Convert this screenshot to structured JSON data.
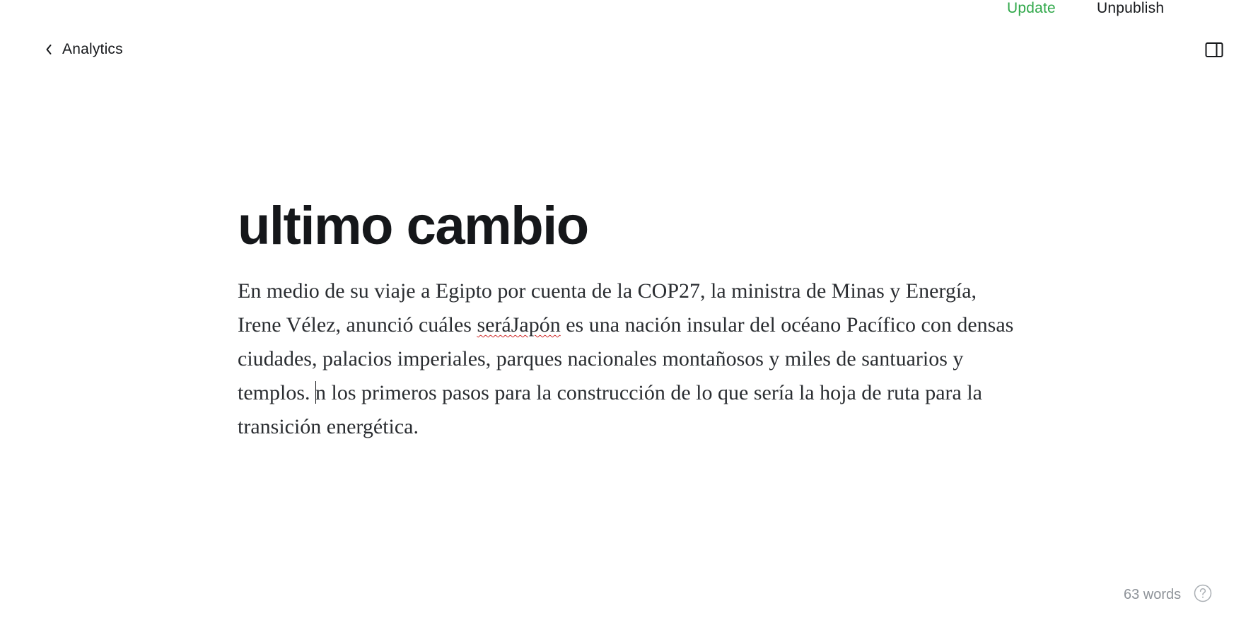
{
  "header": {
    "back_label": "Analytics",
    "update_label": "Update",
    "unpublish_label": "Unpublish",
    "back_icon": "chevron-left-icon",
    "sidebar_icon": "sidebar-panel-icon"
  },
  "post": {
    "title": "ultimo cambio",
    "body_part1": "En medio de su viaje a Egipto por cuenta de la COP27, la ministra de Minas y Energía, Irene Vélez, anunció cuáles ",
    "body_misspelled": "seráJapón",
    "body_part2": " es una nación insular del océano Pacífico con densas ciudades, palacios imperiales, parques nacionales montañosos y miles de santuarios y templos. ",
    "body_part3": "n los primeros pasos para la construcción de lo que sería la hoja de ruta para la transición energética."
  },
  "footer": {
    "word_count": "63 words",
    "help_icon": "help-circle-icon"
  },
  "colors": {
    "accent_green": "#30a84a",
    "text_dark": "#15171a",
    "muted": "#8e9399",
    "spellcheck_red": "#d12f2f"
  }
}
